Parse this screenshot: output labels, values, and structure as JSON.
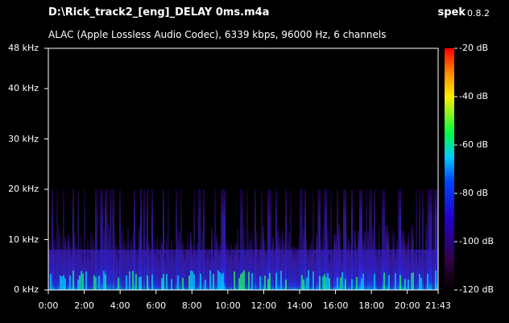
{
  "window": {
    "filename": "D:\\Rick_track2_[eng]_DELAY 0ms.m4a",
    "app_name": "spek",
    "app_version": "0.8.2",
    "info": "ALAC (Apple Lossless Audio Codec), 6339 kbps, 96000 Hz, 6 channels"
  },
  "axes": {
    "y_ticks": [
      "48 kHz",
      "40 kHz",
      "30 kHz",
      "20 kHz",
      "10 kHz",
      "0 kHz"
    ],
    "y_values": [
      48,
      40,
      30,
      20,
      10,
      0
    ],
    "x_ticks": [
      "0:00",
      "2:00",
      "4:00",
      "6:00",
      "8:00",
      "10:00",
      "12:00",
      "14:00",
      "16:00",
      "18:00",
      "20:00",
      "21:43"
    ],
    "x_values_sec": [
      0,
      120,
      240,
      360,
      480,
      600,
      720,
      840,
      960,
      1080,
      1200,
      1303
    ],
    "x_max_sec": 1303,
    "y_max_khz": 48
  },
  "colorbar": {
    "labels": [
      "-20 dB",
      "-40 dB",
      "-60 dB",
      "-80 dB",
      "-100 dB",
      "-120 dB"
    ],
    "values": [
      -20,
      -40,
      -60,
      -80,
      -100,
      -120
    ],
    "colors": [
      "#ff0000",
      "#ff8800",
      "#ffff00",
      "#00ff00",
      "#00ccff",
      "#0000ff",
      "#6600aa",
      "#000000"
    ]
  }
}
